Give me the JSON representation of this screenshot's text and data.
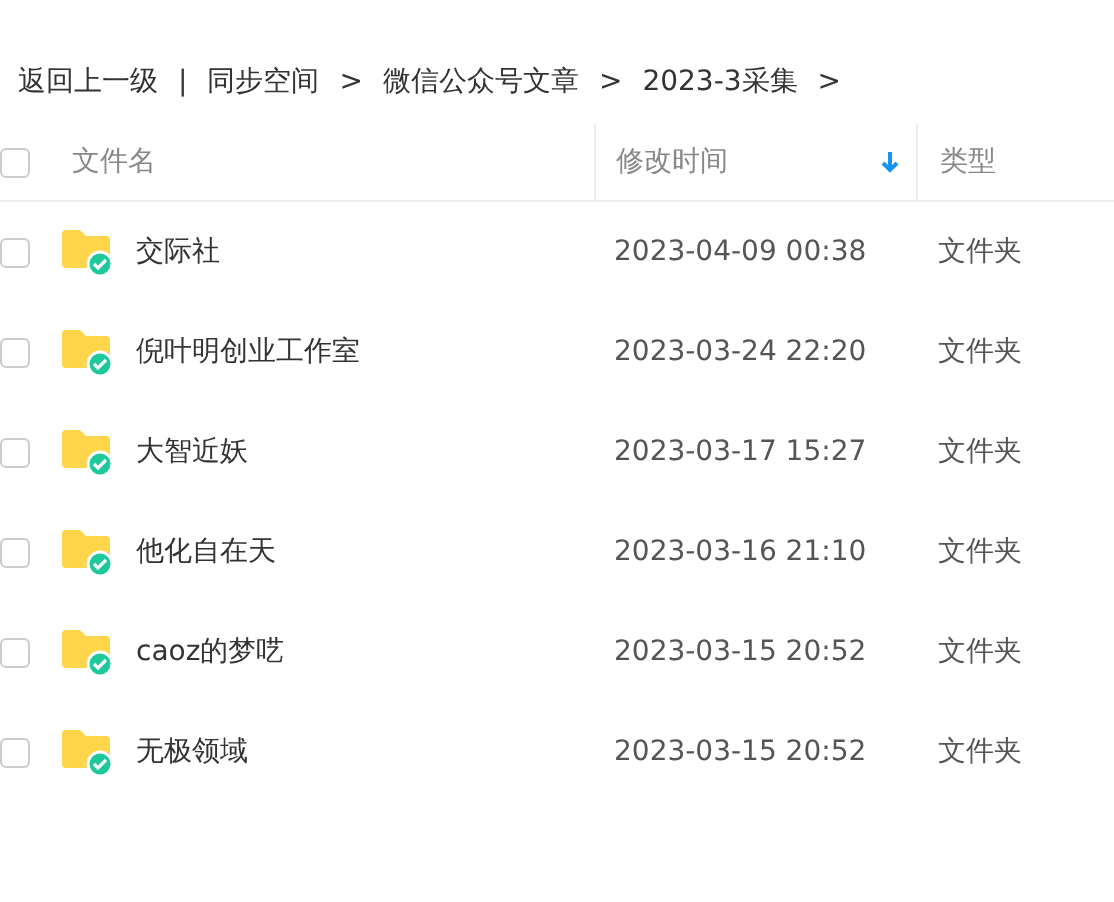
{
  "breadcrumb": [
    {
      "label": "返回上一级",
      "separator": "|"
    },
    {
      "label": "同步空间",
      "separator": ">"
    },
    {
      "label": "微信公众号文章",
      "separator": ">"
    },
    {
      "label": "2023-3采集",
      "separator": ">"
    }
  ],
  "table": {
    "select_all": {
      "checked": false
    },
    "columns": [
      {
        "label": "文件名",
        "sorted": false
      },
      {
        "label": "修改时间",
        "sorted": true
      },
      {
        "label": "类型",
        "sorted": false
      }
    ],
    "rows": [
      {
        "checked": false,
        "name": "交际社",
        "modified": "2023-04-09 00:38",
        "type": "文件夹"
      },
      {
        "checked": false,
        "name": "倪叶明创业工作室",
        "modified": "2023-03-24 22:20",
        "type": "文件夹"
      },
      {
        "checked": false,
        "name": "大智近妖",
        "modified": "2023-03-17 15:27",
        "type": "文件夹"
      },
      {
        "checked": false,
        "name": "他化自在天",
        "modified": "2023-03-16 21:10",
        "type": "文件夹"
      },
      {
        "checked": false,
        "name": "caoz的梦呓",
        "modified": "2023-03-15 20:52",
        "type": "文件夹"
      },
      {
        "checked": false,
        "name": "无极领域",
        "modified": "2023-03-15 20:52",
        "type": "文件夹"
      }
    ]
  }
}
